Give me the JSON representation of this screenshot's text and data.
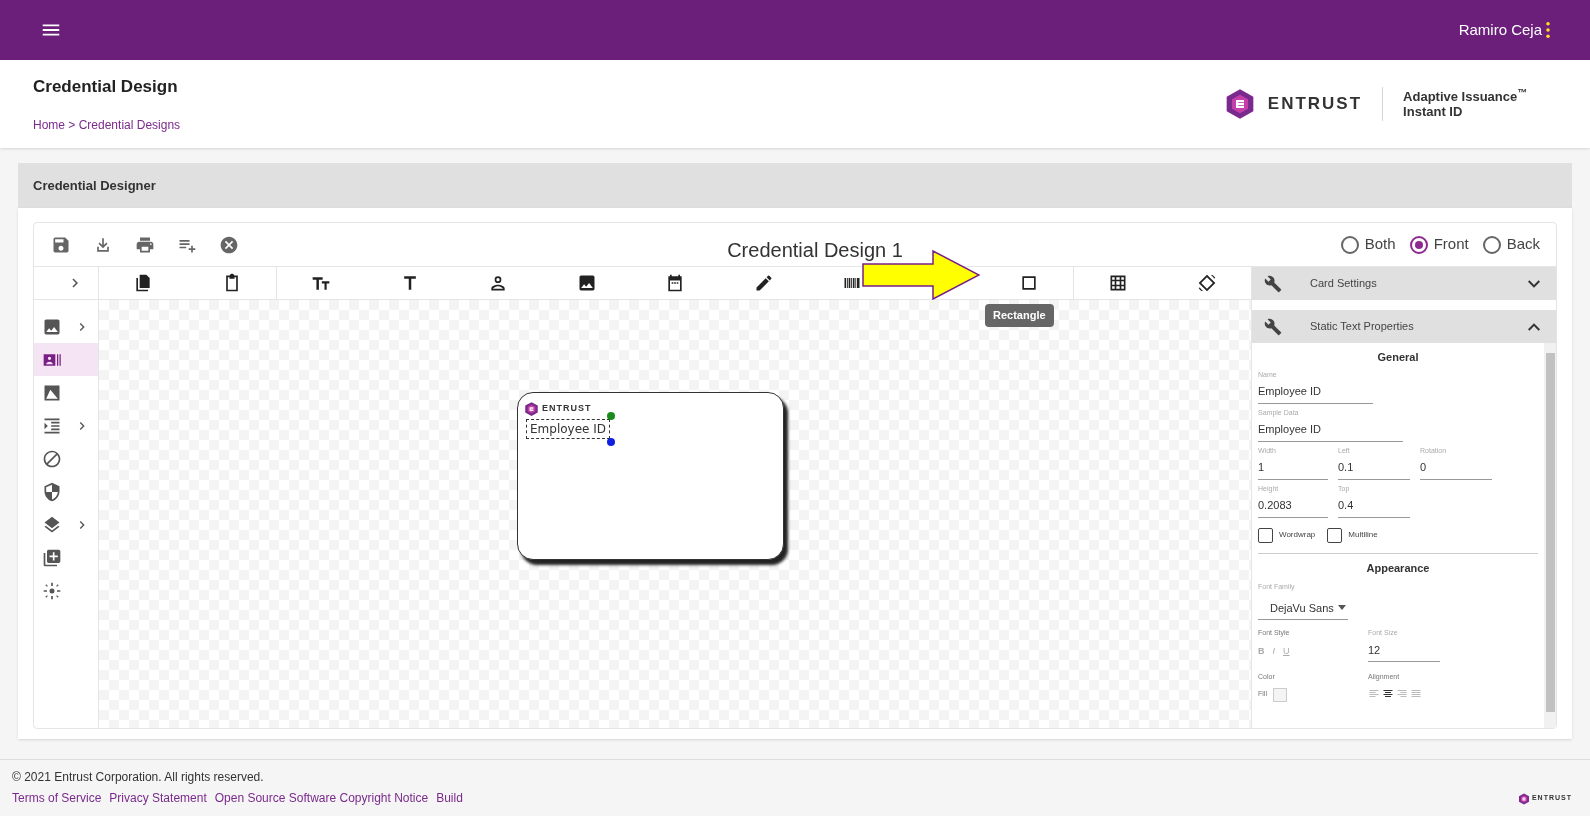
{
  "app_bar": {
    "user": "Ramiro Ceja"
  },
  "header": {
    "title": "Credential Design",
    "breadcrumb": "Home > Credential Designs",
    "brand": {
      "wordmark": "ENTRUST",
      "product_line_1": "Adaptive Issuance$^{™}$",
      "product_line_2": "Instant ID"
    }
  },
  "section_title": "Credential Designer",
  "designer": {
    "title": "Credential Design 1",
    "actions": [
      {
        "kind": "save"
      },
      {
        "kind": "download"
      },
      {
        "kind": "print"
      },
      {
        "kind": "add-list"
      },
      {
        "kind": "cancel"
      }
    ],
    "sides": [
      {
        "label": "Both",
        "selected": false
      },
      {
        "label": "Front",
        "selected": true
      },
      {
        "label": "Back",
        "selected": false
      }
    ],
    "tools": [
      {
        "kind": "copy"
      },
      {
        "kind": "clipboard"
      },
      {
        "kind": "text-size"
      },
      {
        "kind": "text"
      },
      {
        "kind": "person"
      },
      {
        "kind": "image"
      },
      {
        "kind": "calendar"
      },
      {
        "kind": "pencil"
      },
      {
        "kind": "barcode"
      },
      {
        "kind": "rectangle"
      },
      {
        "kind": "grid"
      },
      {
        "kind": "rotate"
      }
    ],
    "tooltip": "Rectangle",
    "rail": [
      {
        "kind": "image",
        "selected": false,
        "submenu": true
      },
      {
        "kind": "id-card",
        "selected": true,
        "submenu": false
      },
      {
        "kind": "photo",
        "selected": false,
        "submenu": false
      },
      {
        "kind": "indent",
        "selected": false,
        "submenu": true
      },
      {
        "kind": "block",
        "selected": false,
        "submenu": false
      },
      {
        "kind": "shield",
        "selected": false,
        "submenu": false
      },
      {
        "kind": "layers",
        "selected": false,
        "submenu": true
      },
      {
        "kind": "add-box",
        "selected": false,
        "submenu": false
      },
      {
        "kind": "center",
        "selected": false,
        "submenu": false
      }
    ],
    "card": {
      "logo_text": "ENTRUST",
      "text_field": "Employee ID"
    }
  },
  "panels": [
    {
      "title": "Card Settings",
      "expanded": false
    },
    {
      "title": "Static Text Properties",
      "expanded": true
    }
  ],
  "properties": {
    "general_heading": "General",
    "fields": [
      {
        "label": "Name",
        "value": "Employee ID"
      },
      {
        "label": "Sample Data",
        "value": "Employee ID"
      },
      {
        "label": "Width",
        "value": "1"
      },
      {
        "label": "Left",
        "value": "0.1"
      },
      {
        "label": "Rotation",
        "value": "0"
      },
      {
        "label": "Height",
        "value": "0.2083"
      },
      {
        "label": "Top",
        "value": "0.4"
      }
    ],
    "checkboxes": [
      {
        "label": "Wordwrap",
        "checked": false
      },
      {
        "label": "Multiline",
        "checked": false
      }
    ],
    "appearance_heading": "Appearance",
    "font_family": {
      "label": "Font Family",
      "value": "DejaVu Sans"
    },
    "font_style": {
      "label": "Font Style",
      "buttons": [
        "B",
        "I",
        "U"
      ]
    },
    "font_size": {
      "label": "Font Size",
      "value": "12"
    },
    "color_label": "Color",
    "fill_label": "Fill",
    "alignment": {
      "label": "Alignment",
      "options": [
        {
          "kind": "left",
          "selected": false
        },
        {
          "kind": "center",
          "selected": true
        },
        {
          "kind": "right",
          "selected": false
        },
        {
          "kind": "justify",
          "selected": false
        }
      ]
    }
  },
  "footer": {
    "copyright": "© 2021 Entrust Corporation. All rights reserved.",
    "links": [
      "Terms of Service",
      "Privacy Statement",
      "Open Source Software Copyright Notice",
      "Build"
    ],
    "logo_text": "ENTRUST"
  }
}
